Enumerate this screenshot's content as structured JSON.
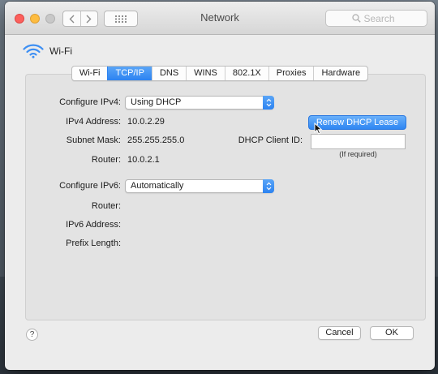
{
  "window": {
    "title": "Network"
  },
  "search": {
    "placeholder": "Search"
  },
  "interface": {
    "name": "Wi-Fi"
  },
  "tabs": [
    {
      "label": "Wi-Fi",
      "active": false
    },
    {
      "label": "TCP/IP",
      "active": true
    },
    {
      "label": "DNS",
      "active": false
    },
    {
      "label": "WINS",
      "active": false
    },
    {
      "label": "802.1X",
      "active": false
    },
    {
      "label": "Proxies",
      "active": false
    },
    {
      "label": "Hardware",
      "active": false
    }
  ],
  "ipv4": {
    "configure_label": "Configure IPv4:",
    "configure_value": "Using DHCP",
    "address_label": "IPv4 Address:",
    "address_value": "10.0.2.29",
    "subnet_label": "Subnet Mask:",
    "subnet_value": "255.255.255.0",
    "router_label": "Router:",
    "router_value": "10.0.2.1"
  },
  "dhcp": {
    "renew_label": "Renew DHCP Lease",
    "client_id_label": "DHCP Client ID:",
    "client_id_value": "",
    "client_id_hint": "(If required)"
  },
  "ipv6": {
    "configure_label": "Configure IPv6:",
    "configure_value": "Automatically",
    "router_label": "Router:",
    "address_label": "IPv6 Address:",
    "prefix_label": "Prefix Length:"
  },
  "footer": {
    "help_label": "?",
    "cancel_label": "Cancel",
    "ok_label": "OK"
  },
  "colors": {
    "accent": "#2c83f1",
    "close": "#fc605c",
    "minimize": "#fdbc40",
    "zoom_inactive": "#c8c8c8"
  },
  "icons": {
    "wifi": "wifi-icon",
    "back": "chevron-left-icon",
    "forward": "chevron-right-icon",
    "grid": "grid-icon",
    "search": "search-icon",
    "popup": "up-down-arrows-icon",
    "cursor": "mouse-pointer-icon"
  }
}
